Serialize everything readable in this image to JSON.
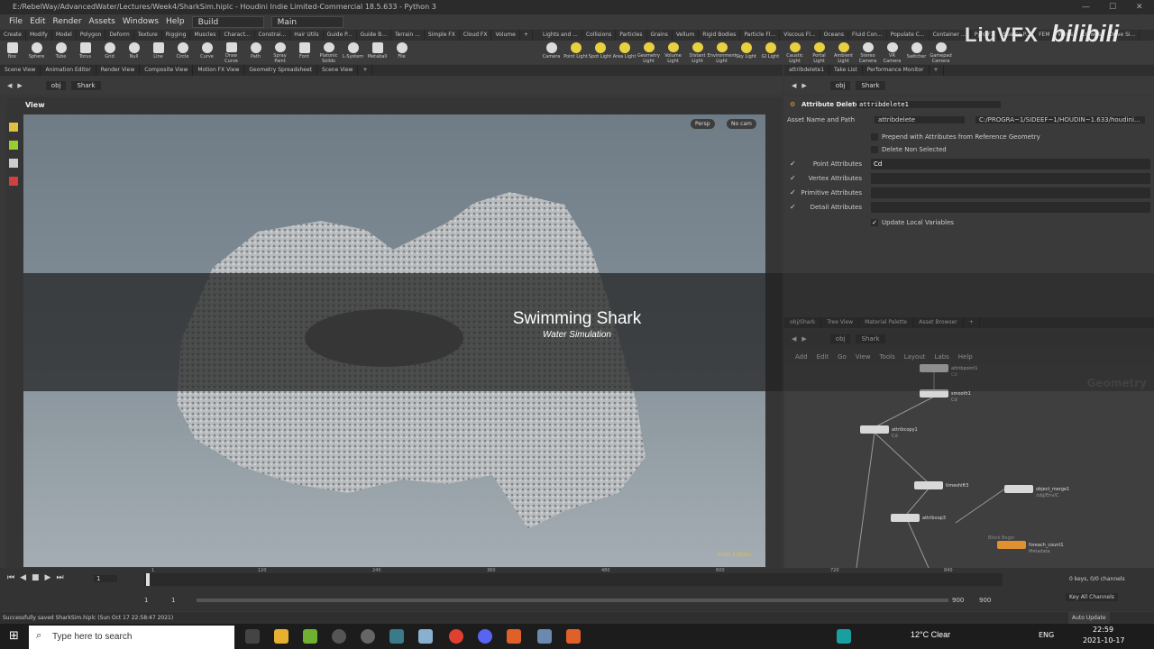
{
  "window": {
    "title": "E:/RebelWay/AdvancedWater/Lectures/Week4/SharkSim.hiplc - Houdini Indie Limited-Commercial 18.5.633 - Python 3"
  },
  "menubar": {
    "items": [
      "File",
      "Edit",
      "Render",
      "Assets",
      "Windows",
      "Help"
    ],
    "build_label": "Build",
    "desktop_label": "Main"
  },
  "shelf_tabs_left": [
    "Create",
    "Modify",
    "Model",
    "Polygon",
    "Deform",
    "Texture",
    "Rigging",
    "Muscles",
    "Charact...",
    "Constrai...",
    "Hair Utils",
    "Guide P...",
    "Guide B...",
    "Terrain ...",
    "Simple FX",
    "Cloud FX",
    "Volume",
    "+"
  ],
  "shelf_tabs_right": [
    "Lights and ...",
    "Collisions",
    "Particles",
    "Grains",
    "Vellum",
    "Rigid Bodies",
    "Particle Fl...",
    "Viscous Fl...",
    "Oceans",
    "Fluid Con...",
    "Populate C...",
    "Container ...",
    "Pyro FX",
    "Sparse P...",
    "FEM",
    "Wires",
    "Crowds",
    "Drive Si..."
  ],
  "shelf_tools_left": [
    {
      "label": "Box",
      "icon": "box-icon"
    },
    {
      "label": "Sphere",
      "icon": "sphere-icon"
    },
    {
      "label": "Tube",
      "icon": "tube-icon"
    },
    {
      "label": "Torus",
      "icon": "torus-icon"
    },
    {
      "label": "Grid",
      "icon": "grid-icon"
    },
    {
      "label": "Null",
      "icon": "null-icon"
    },
    {
      "label": "Line",
      "icon": "line-icon"
    },
    {
      "label": "Circle",
      "icon": "circle-icon"
    },
    {
      "label": "Curve",
      "icon": "curve-icon"
    },
    {
      "label": "Draw Curve",
      "icon": "draw-curve-icon"
    },
    {
      "label": "Path",
      "icon": "path-icon"
    },
    {
      "label": "Spray Paint",
      "icon": "spray-paint-icon"
    },
    {
      "label": "Font",
      "icon": "font-icon"
    },
    {
      "label": "Platonic Solids",
      "icon": "platonic-icon"
    },
    {
      "label": "L-System",
      "icon": "lsystem-icon"
    },
    {
      "label": "Metaball",
      "icon": "metaball-icon"
    },
    {
      "label": "File",
      "icon": "file-icon"
    }
  ],
  "shelf_tools_right": [
    {
      "label": "Camera",
      "icon": "camera-icon"
    },
    {
      "label": "Point Light",
      "icon": "point-light-icon"
    },
    {
      "label": "Spot Light",
      "icon": "spot-light-icon"
    },
    {
      "label": "Area Light",
      "icon": "area-light-icon"
    },
    {
      "label": "Geometry Light",
      "icon": "geometry-light-icon"
    },
    {
      "label": "Volume Light",
      "icon": "volume-light-icon"
    },
    {
      "label": "Distant Light",
      "icon": "distant-light-icon"
    },
    {
      "label": "Environment Light",
      "icon": "environment-light-icon"
    },
    {
      "label": "Sky Light",
      "icon": "sky-light-icon"
    },
    {
      "label": "GI Light",
      "icon": "gi-light-icon"
    },
    {
      "label": "Caustic Light",
      "icon": "caustic-light-icon"
    },
    {
      "label": "Portal Light",
      "icon": "portal-light-icon"
    },
    {
      "label": "Ambient Light",
      "icon": "ambient-light-icon"
    },
    {
      "label": "Stereo Camera",
      "icon": "stereo-camera-icon"
    },
    {
      "label": "VR Camera",
      "icon": "vr-camera-icon"
    },
    {
      "label": "Switcher",
      "icon": "switcher-icon"
    },
    {
      "label": "Gamepad Camera",
      "icon": "gamepad-camera-icon"
    }
  ],
  "pane_tabs_left": [
    "Scene View",
    "Animation Editor",
    "Render View",
    "Composite View",
    "Motion FX View",
    "Geometry Spreadsheet",
    "Scene View",
    "+"
  ],
  "pane_tabs_right": [
    "attribdelete1",
    "Take List",
    "Performance Monitor",
    "+"
  ],
  "viewport": {
    "path_root": "obj",
    "path_node": "Shark",
    "header": "View",
    "persp_label": "Persp",
    "cam_label": "No cam",
    "license_tag": "Indie Edition"
  },
  "overlay": {
    "title": "Swimming Shark",
    "subtitle": "Water Simulation"
  },
  "params": {
    "path_root": "obj",
    "path_node": "Shark",
    "node_type": "Attribute Delete",
    "node_name": "attribdelete1",
    "asset_label": "Asset Name and Path",
    "asset_value": "attribdelete",
    "asset_path": "C:/PROGRA~1/SIDEEF~1/HOUDIN~1.633/houdini...",
    "prepend_label": "Prepend with Attributes from Reference Geometry",
    "delete_non_selected": "Delete Non Selected",
    "rows": [
      {
        "label": "Point Attributes",
        "value": "Cd",
        "checked": true
      },
      {
        "label": "Vertex Attributes",
        "value": "",
        "checked": true
      },
      {
        "label": "Primitive Attributes",
        "value": "",
        "checked": true
      },
      {
        "label": "Detail Attributes",
        "value": "",
        "checked": true
      }
    ],
    "update_local": "Update Local Variables"
  },
  "network": {
    "tabs": [
      "obj/Shark",
      "Tree View",
      "Material Palette",
      "Asset Browser",
      "+"
    ],
    "path_root": "obj",
    "path_node": "Shark",
    "menu": [
      "Add",
      "Edit",
      "Go",
      "View",
      "Tools",
      "Layout",
      "Labs",
      "Help"
    ],
    "context_label": "Geometry",
    "nodes": [
      {
        "name": "attribpoint1",
        "sub": "Cd"
      },
      {
        "name": "smooth1",
        "sub": "Cd"
      },
      {
        "name": "attribcopy1",
        "sub": "Cd"
      },
      {
        "name": "timeshift3",
        "sub": ""
      },
      {
        "name": "object_merge1",
        "sub": "/obj/Env/C"
      },
      {
        "name": "attribvop3",
        "sub": ""
      },
      {
        "name": "foreach_count1",
        "sub": "Metadata"
      },
      {
        "name": "Block Begin",
        "sub": ""
      }
    ]
  },
  "timeline": {
    "ticks": [
      "1",
      "120",
      "240",
      "360",
      "480",
      "600",
      "720",
      "840"
    ],
    "current_frame": "1",
    "start": "1",
    "end_a": "900",
    "end_b": "900",
    "range_start_a": "1",
    "range_start_b": "1",
    "keys_label": "0 keys, 0/0 channels",
    "key_all": "Key All Channels",
    "auto_update": "Auto Update"
  },
  "status": {
    "message": "Successfully saved SharkSim.hiplc (Sun Oct 17 22:58:47 2021)"
  },
  "taskbar": {
    "search_placeholder": "Type here to search",
    "weather": "12°C  Clear",
    "lang": "ENG",
    "time": "22:59",
    "date": "2021-10-17"
  },
  "watermark": {
    "brand": "LiuVFX",
    "site": "bilibili"
  }
}
